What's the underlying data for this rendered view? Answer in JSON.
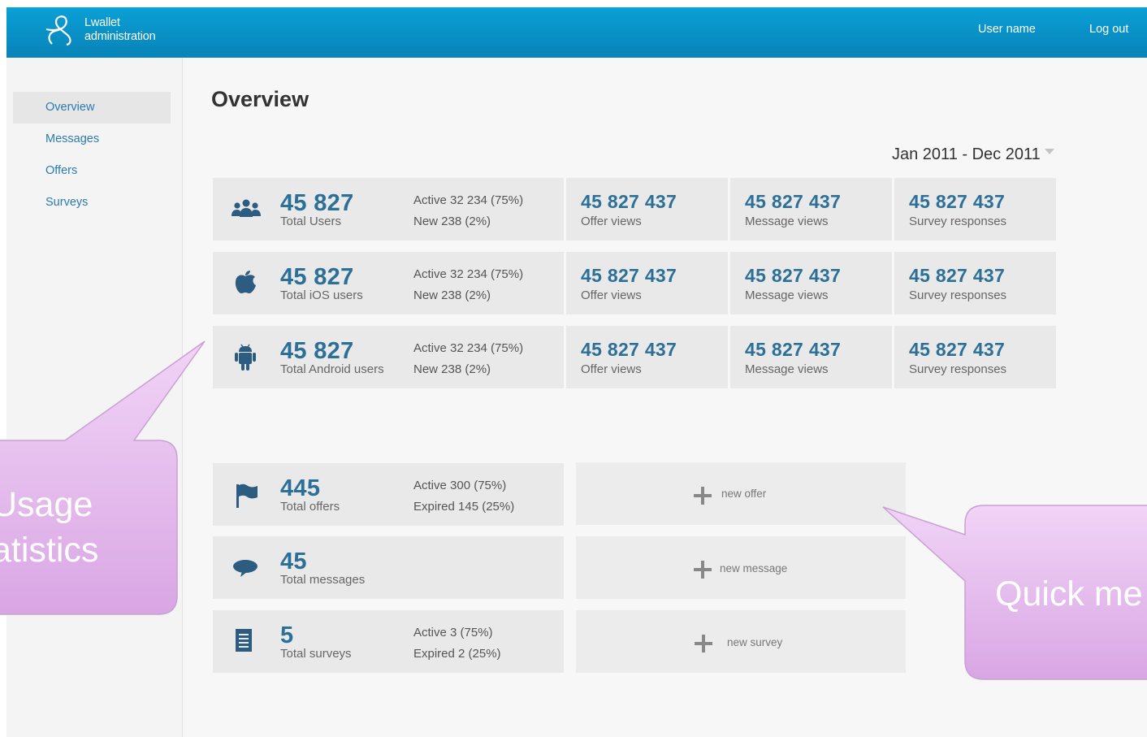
{
  "header": {
    "brand_line1": "Lwallet",
    "brand_line2": "administration",
    "user_name": "User name",
    "logout": "Log out"
  },
  "sidebar": {
    "items": [
      {
        "label": "Overview",
        "active": true
      },
      {
        "label": "Messages"
      },
      {
        "label": "Offers"
      },
      {
        "label": "Surveys"
      }
    ]
  },
  "main": {
    "title": "Overview",
    "date_range": "Jan 2011 - Dec 2011",
    "stat_rows": [
      {
        "icon": "users-icon",
        "total": "45 827",
        "total_label": "Total Users",
        "active": "Active 32 234 (75%)",
        "new": "New 238 (2%)",
        "offer_views": "45 827 437",
        "offer_label": "Offer views",
        "message_views": "45 827 437",
        "message_label": "Message views",
        "survey_responses": "45 827 437",
        "survey_label": "Survey responses"
      },
      {
        "icon": "apple-icon",
        "total": "45 827",
        "total_label": "Total iOS users",
        "active": "Active 32 234 (75%)",
        "new": "New 238 (2%)",
        "offer_views": "45 827 437",
        "offer_label": "Offer views",
        "message_views": "45 827 437",
        "message_label": "Message views",
        "survey_responses": "45 827 437",
        "survey_label": "Survey responses"
      },
      {
        "icon": "android-icon",
        "total": "45 827",
        "total_label": "Total Android users",
        "active": "Active 32 234 (75%)",
        "new": "New 238 (2%)",
        "offer_views": "45 827 437",
        "offer_label": "Offer views",
        "message_views": "45 827 437",
        "message_label": "Message views",
        "survey_responses": "45 827 437",
        "survey_label": "Survey responses"
      }
    ],
    "content_rows": [
      {
        "icon": "flag-icon",
        "total": "445",
        "label": "Total offers",
        "line1": "Active 300 (75%)",
        "line2": "Expired 145 (25%)",
        "action": "new offer"
      },
      {
        "icon": "speech-bubble-icon",
        "total": "45",
        "label": "Total messages",
        "line1": "",
        "line2": "",
        "action": "new message"
      },
      {
        "icon": "document-icon",
        "total": "5",
        "label": "Total surveys",
        "line1": "Active 3 (75%)",
        "line2": "Expired 2 (25%)",
        "action": "new survey"
      }
    ]
  },
  "callouts": {
    "left_line1": "Usage",
    "left_line2": "atistics",
    "right": "Quick me"
  },
  "colors": {
    "header": "#0a93c9",
    "link": "#2a7bb0",
    "stat_number": "#2c7098",
    "tile": "#e9e9e9",
    "callout": "#e8c2f0"
  }
}
